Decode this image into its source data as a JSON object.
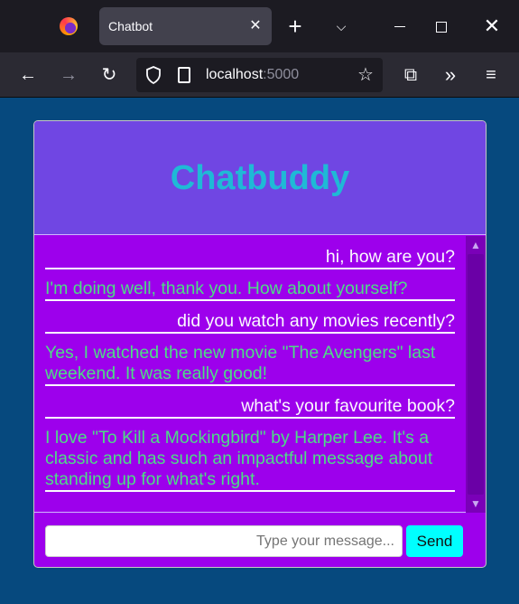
{
  "browser": {
    "tab_title": "Chatbot",
    "tab_close": "✕",
    "new_tab": "+",
    "tab_list": "⌵",
    "close_window": "✕",
    "url_host": "localhost",
    "url_port": ":5000",
    "icons": {
      "back": "arrow-left-icon",
      "forward": "arrow-right-icon",
      "reload": "reload-icon",
      "shield": "shield-icon",
      "page": "page-icon",
      "bookmark": "star-icon",
      "extensions": "puzzle-icon",
      "more_tools": "chevron-double-right-icon",
      "menu": "hamburger-icon"
    },
    "glyphs": {
      "back": "←",
      "forward": "→",
      "reload": "↻",
      "star": "☆",
      "extensions": "⧉",
      "more_tools": "»",
      "menu": "≡"
    }
  },
  "chat": {
    "title": "Chatbuddy",
    "messages": [
      {
        "role": "user",
        "text": "hi, how are you?"
      },
      {
        "role": "bot",
        "text": "I'm doing well, thank you. How about yourself?"
      },
      {
        "role": "user",
        "text": "did you watch any movies recently?"
      },
      {
        "role": "bot",
        "text": "Yes, I watched the new movie \"The Avengers\" last weekend. It was really good!"
      },
      {
        "role": "user",
        "text": "what's your favourite book?"
      },
      {
        "role": "bot",
        "text": "I love \"To Kill a Mockingbird\" by Harper Lee. It's a classic and has such an impactful message about standing up for what's right."
      }
    ],
    "input": {
      "value": "",
      "placeholder": "Type your message..."
    },
    "send_label": "Send",
    "scroll_up": "▲",
    "scroll_down": "▼"
  },
  "colors": {
    "page_bg": "#06497e",
    "header_bg": "#7046e3",
    "title_color": "#1fb9d6",
    "chat_bg": "#9d00ec",
    "user_text": "#fbfbfe",
    "bot_text": "#4edc86",
    "send_bg": "#00ffff"
  }
}
